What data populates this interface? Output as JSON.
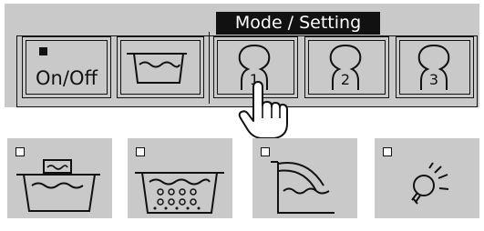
{
  "header": {
    "mode_label": "Mode / Setting"
  },
  "buttons": {
    "on_off_label": "On/Off",
    "memory": [
      {
        "number": "1"
      },
      {
        "number": "2"
      },
      {
        "number": "3"
      }
    ]
  },
  "colors": {
    "panel": "#c9c9c9",
    "label_bg": "#111111",
    "label_text": "#ffffff",
    "line": "#111111"
  },
  "icons": [
    "bath-fill-icon",
    "user-memory-1-icon",
    "user-memory-2-icon",
    "user-memory-3-icon",
    "bath-heat-icon",
    "bath-bubbles-icon",
    "bath-refill-icon",
    "light-icon",
    "hand-cursor-icon"
  ]
}
